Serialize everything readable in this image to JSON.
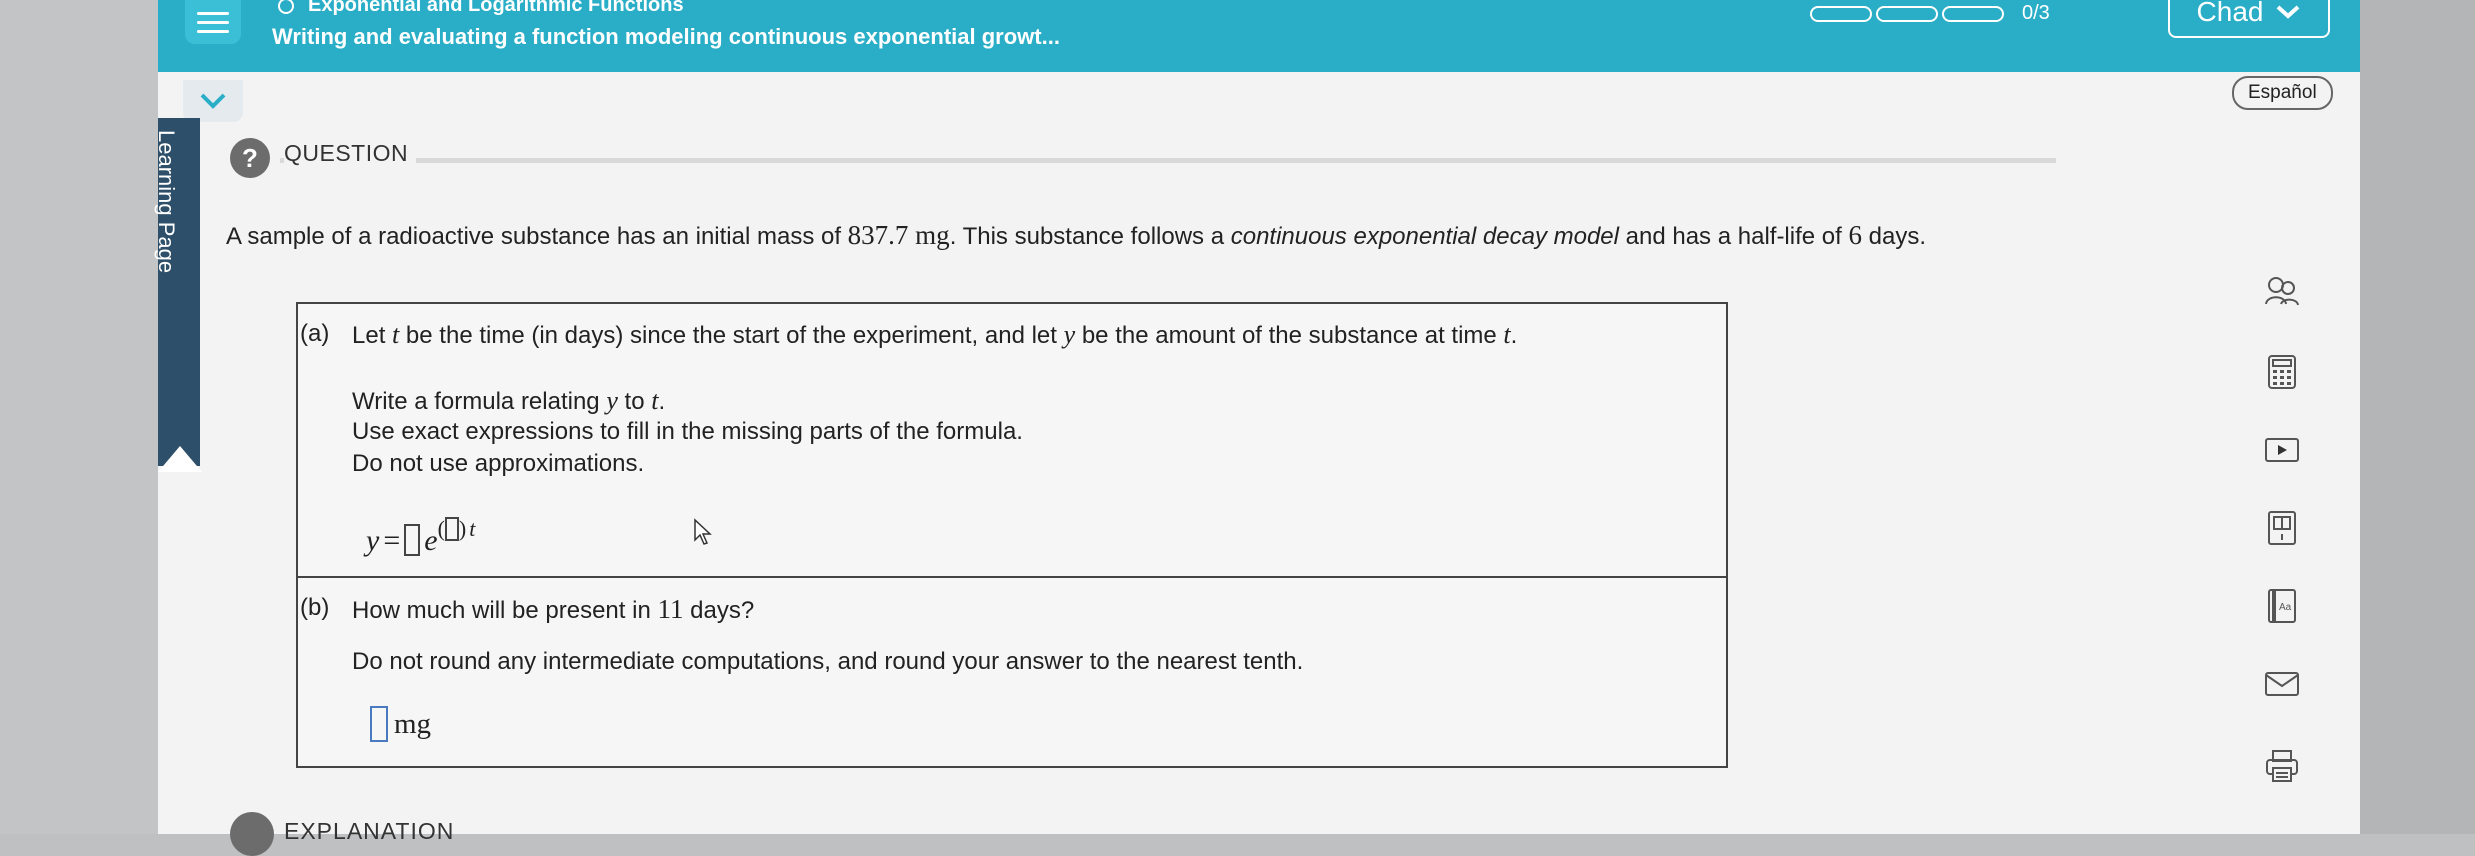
{
  "header": {
    "topic": "Exponential and Logarithmic Functions",
    "title": "Writing and evaluating a function modeling continuous exponential growt...",
    "progress_text": "0/3",
    "progress_segments": 3,
    "progress_completed": 0,
    "user_name": "Chad"
  },
  "sidebar": {
    "learning_page_label": "Learning Page"
  },
  "language_button": "Español",
  "question": {
    "label": "QUESTION",
    "prompt": {
      "p1": "A sample of a radioactive substance has an initial mass of ",
      "mass": "837.7 mg",
      "p2": ". This substance follows a ",
      "model": "continuous exponential decay model",
      "p3": " and has a half-life of ",
      "halflife": "6",
      "p4": " days."
    },
    "part_a": {
      "tag": "(a)",
      "l1a": "Let ",
      "l1v1": "t",
      "l1b": " be the time (in days) since the start of the experiment, and let ",
      "l1v2": "y",
      "l1c": " be the amount of the substance at time ",
      "l1v3": "t",
      "l1d": ".",
      "l2a": "Write a formula relating ",
      "l2v1": "y",
      "l2b": " to ",
      "l2v2": "t",
      "l2c": ".",
      "l3": "Use exact expressions to fill in the missing parts of the formula.",
      "l4": "Do not use approximations.",
      "f_y": "y",
      "f_eq": "=",
      "f_e": "e",
      "f_open": "(",
      "f_close": ")",
      "f_t": "t"
    },
    "part_b": {
      "tag": "(b)",
      "l1a": "How much will be present in ",
      "l1num": "11",
      "l1b": " days?",
      "l2": "Do not round any intermediate computations, and round your answer to the nearest tenth.",
      "unit": "mg"
    }
  },
  "tools": [
    "people-icon",
    "calculator-icon",
    "video-icon",
    "textbook-icon",
    "glossary-icon",
    "email-icon",
    "print-icon"
  ],
  "explanation_label": "EXPLANATION",
  "colors": {
    "header": "#2aaec7",
    "sidebar_tab": "#2d4f69",
    "input_border": "#4a7abf"
  }
}
